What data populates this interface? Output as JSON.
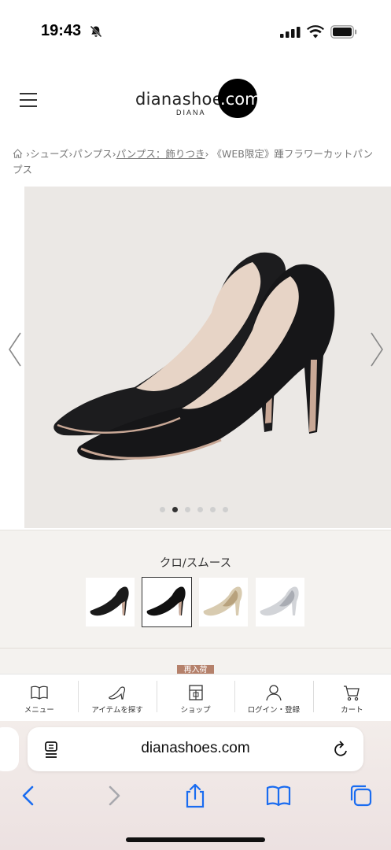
{
  "status_bar": {
    "time": "19:43"
  },
  "header": {
    "logo_main": "dianashoes",
    "logo_com": ".com",
    "logo_sub": "DIANA"
  },
  "breadcrumb": {
    "items": [
      "シューズ",
      "パンプス",
      "パンプス：飾りつき"
    ],
    "current": "《WEB限定》踵フラワーカットパンプス"
  },
  "gallery": {
    "slide_count": 6,
    "active_slide": 2
  },
  "product": {
    "color_name": "クロ/スムース",
    "swatches": [
      {
        "name": "black-suede",
        "color": "#1a1a1a"
      },
      {
        "name": "black-smooth",
        "color": "#111111",
        "selected": true
      },
      {
        "name": "gold",
        "color": "#d8cbb0"
      },
      {
        "name": "silver",
        "color": "#d2d4d8"
      }
    ],
    "badge": "再入荷"
  },
  "bottom_nav": [
    {
      "id": "menu",
      "label": "メニュー"
    },
    {
      "id": "search",
      "label": "アイテムを探す"
    },
    {
      "id": "shop",
      "label": "ショップ"
    },
    {
      "id": "login",
      "label": "ログイン・登録"
    },
    {
      "id": "cart",
      "label": "カート"
    }
  ],
  "safari": {
    "url": "dianashoes.com"
  },
  "colors": {
    "accent_badge": "#b5816b",
    "photo_bg": "#ebe8e5",
    "section_bg": "#f4f2ef"
  }
}
